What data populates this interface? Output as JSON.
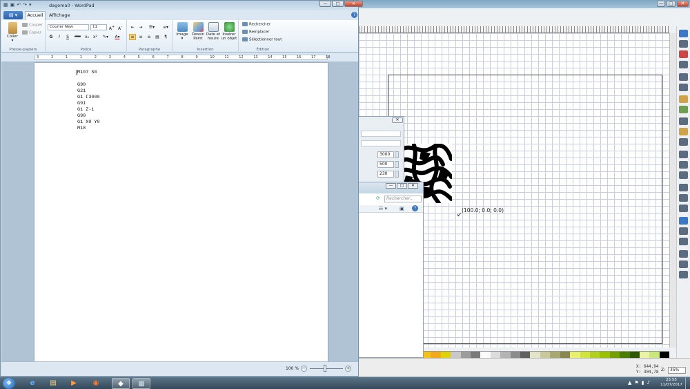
{
  "wordpad": {
    "title": "dagoma0 - WordPad",
    "window_buttons": {
      "minimize": "—",
      "maximize": "□",
      "close": "✕"
    },
    "tabs": {
      "file": "▤ ▾",
      "home": "Accueil",
      "view": "Affichage"
    },
    "help": "?",
    "clipboard": {
      "paste": "Coller",
      "cut": "Couper",
      "copy": "Copier",
      "group": "Presse-papiers"
    },
    "font": {
      "family": "Courier New",
      "size": "11",
      "group": "Police",
      "bold": "G",
      "italic": "I",
      "underline": "S",
      "strike": "abc",
      "sub": "x₂",
      "sup": "x²"
    },
    "paragraph": {
      "group": "Paragraphe"
    },
    "insert": {
      "image": "Image",
      "paint": "Dessin Paint",
      "datetime": "Date et heure",
      "object": "Insérer un objet",
      "group": "Insertion"
    },
    "editing": {
      "find": "Rechercher",
      "replace": "Remplacer",
      "select_all": "Sélectionner tout",
      "group": "Édition"
    },
    "ruler_numbers": [
      "3",
      "2",
      "1",
      "1",
      "2",
      "3",
      "4",
      "5",
      "6",
      "7",
      "8",
      "9",
      "10",
      "11",
      "12",
      "13",
      "14",
      "15",
      "16",
      "17",
      "18"
    ],
    "document_lines": "M107 S0\n\nG90\nG21\nG1 F3000\nG91\nG1 Z-1\nG90\nG1 X0 Y0\nM18",
    "zoom": "100 %",
    "zoom_minus": "−",
    "zoom_plus": "+"
  },
  "inkscape": {
    "coord_label": "(100.0; 0.0; 0.0)",
    "coord_arrow": "↙",
    "cursor_x": "X:  644,94",
    "cursor_y": "Y:  304,78",
    "zoom_label": "Z:",
    "zoom": "35%"
  },
  "dialog": {
    "close": "✕",
    "values": [
      "3000",
      "500",
      "230"
    ]
  },
  "explorer": {
    "search_placeholder": "Rechercher...",
    "buttons": {
      "minimize": "—",
      "maximize": "□",
      "close": "✕"
    }
  },
  "taskbar": {
    "start": "❖",
    "apps": [
      "e",
      "▤",
      "▶",
      "◉",
      "◆",
      "▦"
    ],
    "tray": [
      "▲",
      "⚑",
      "▮",
      "♪"
    ],
    "time": "23:55",
    "date": "11/07/2017"
  },
  "colors": {
    "accent": "#2c62aa",
    "ribbon_bg": "#e2ecf5",
    "palette": [
      "#f2c21a",
      "#f2a91a",
      "#e0d200",
      "#c8c8c8",
      "#9c9c9c",
      "#7a7a7a",
      "#fafafa",
      "#dcdcdc",
      "#b4b4b4",
      "#8c8c8c",
      "#606060",
      "#e4e4c8",
      "#c8c89a",
      "#a8a870",
      "#88884e",
      "#e8f06e",
      "#d0e43c",
      "#b4d01e",
      "#9ac000",
      "#72a000",
      "#4c7c00",
      "#2c5800",
      "#eaf4a4",
      "#c8e87a",
      "#000000"
    ]
  }
}
